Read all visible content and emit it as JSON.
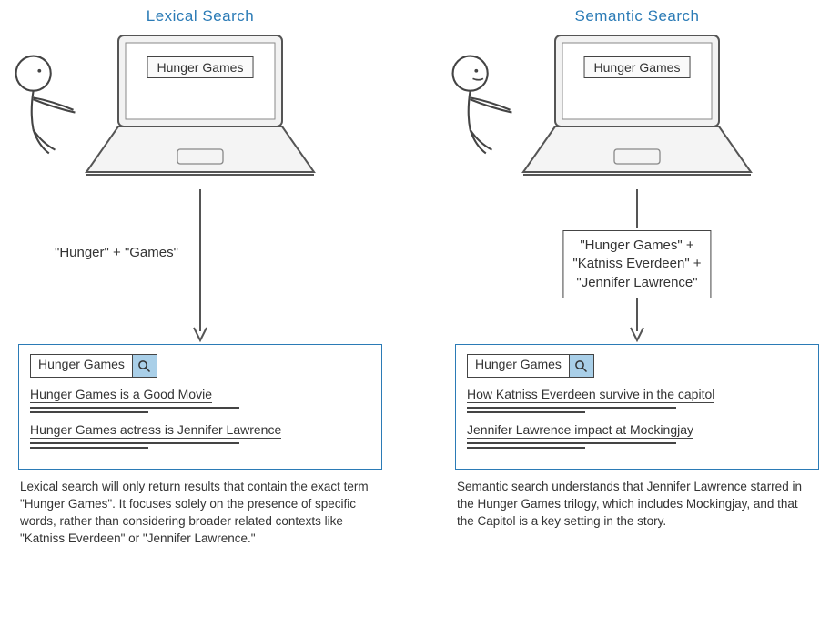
{
  "lexical": {
    "title": "Lexical Search",
    "laptop_query": "Hunger Games",
    "arrow_label": "\"Hunger\" + \"Games\"",
    "search_value": "Hunger Games",
    "results": [
      "Hunger Games is a Good Movie",
      "Hunger Games actress is Jennifer Lawrence"
    ],
    "caption": "Lexical search will only return results that contain the exact term \"Hunger Games\". It focuses solely on the presence of specific words, rather than considering broader related contexts like \"Katniss Everdeen\" or \"Jennifer Lawrence.\""
  },
  "semantic": {
    "title": "Semantic Search",
    "laptop_query": "Hunger Games",
    "arrow_label_line1": "\"Hunger Games\" +",
    "arrow_label_line2": "\"Katniss Everdeen\" +",
    "arrow_label_line3": "\"Jennifer Lawrence\"",
    "search_value": "Hunger Games",
    "results": [
      "How Katniss Everdeen survive in the capitol",
      "Jennifer Lawrence impact at Mockingjay"
    ],
    "caption": "Semantic search understands that Jennifer Lawrence starred in the Hunger Games trilogy, which includes Mockingjay, and that the Capitol is a key setting in the story."
  },
  "colors": {
    "accent": "#2b7bb6",
    "search_btn": "#a9cfe8"
  }
}
